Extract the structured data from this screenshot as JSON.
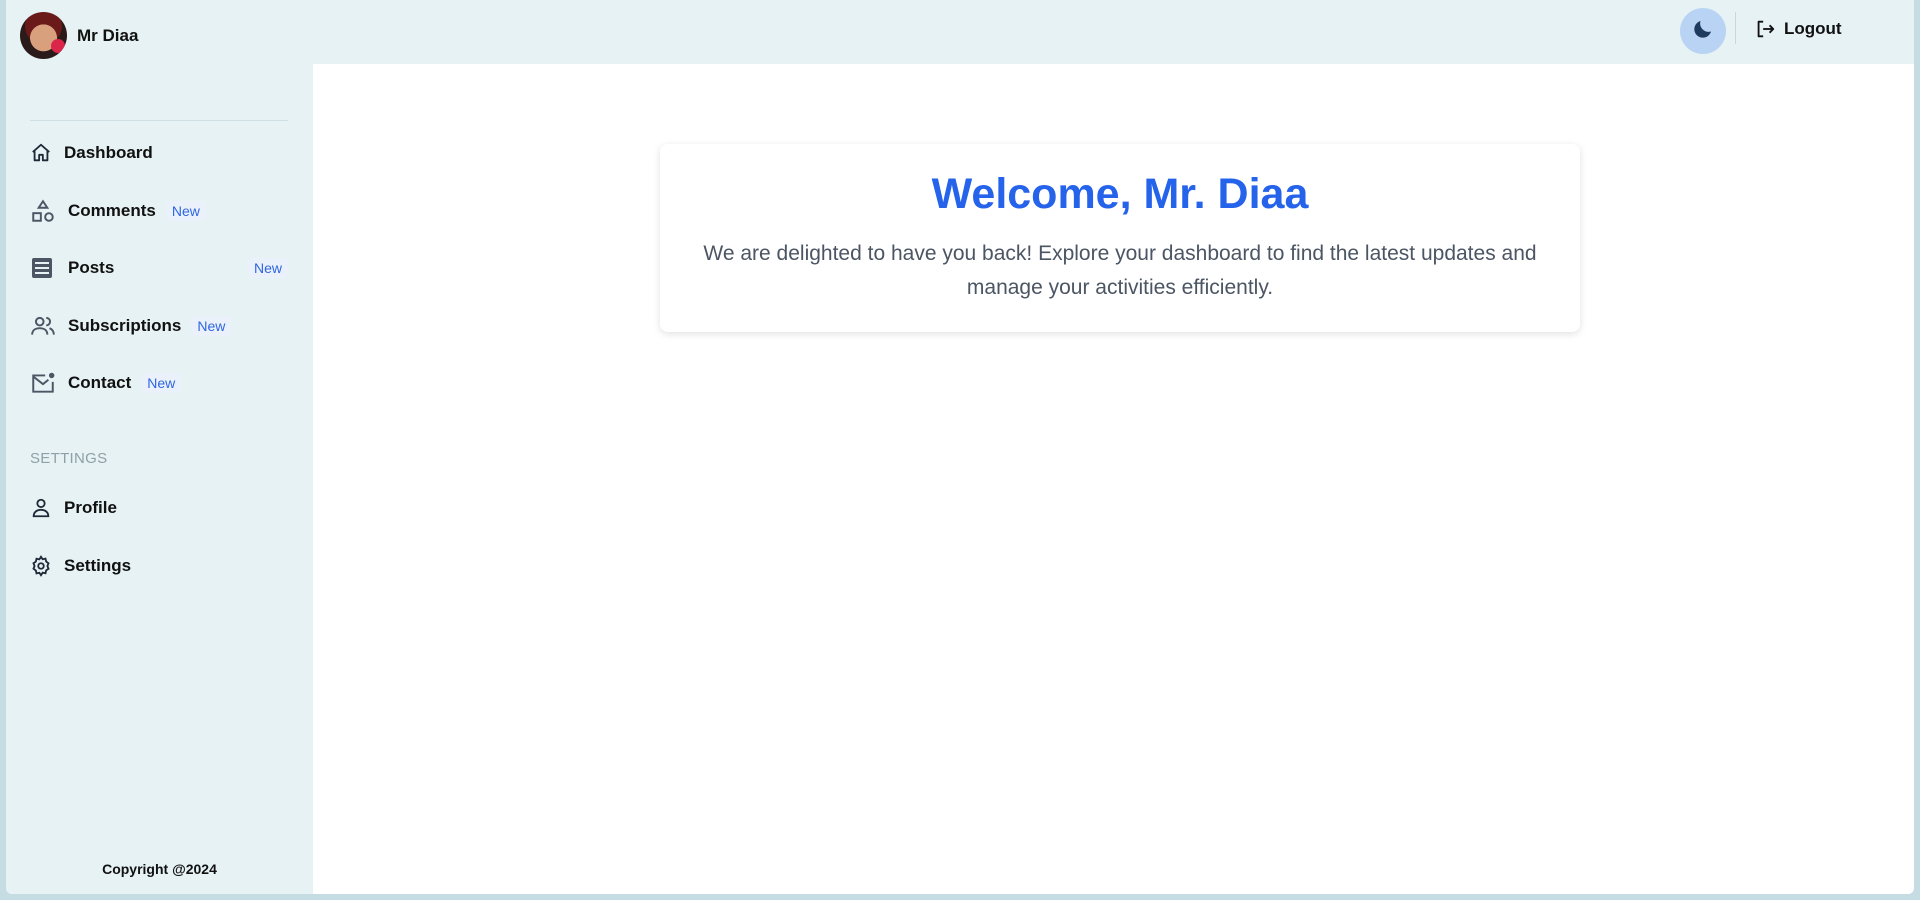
{
  "user": {
    "name": "Mr Diaa"
  },
  "header": {
    "logout_label": "Logout"
  },
  "sidebar": {
    "items": [
      {
        "label": "Dashboard",
        "badge": ""
      },
      {
        "label": "Comments",
        "badge": "New"
      },
      {
        "label": "Posts",
        "badge": "New"
      },
      {
        "label": "Subscriptions",
        "badge": "New"
      },
      {
        "label": "Contact",
        "badge": "New"
      }
    ],
    "settings_title": "SETTINGS",
    "settings_items": [
      {
        "label": "Profile"
      },
      {
        "label": "Settings"
      }
    ],
    "copyright": "Copyright @2024"
  },
  "main": {
    "welcome_title": "Welcome, Mr. Diaa",
    "welcome_text": "We are delighted to have you back! Explore your dashboard to find the latest updates and manage your activities efficiently."
  },
  "colors": {
    "accent": "#2563eb",
    "badge": "#2e66e0",
    "sidebar_bg": "#e6f2f4"
  }
}
